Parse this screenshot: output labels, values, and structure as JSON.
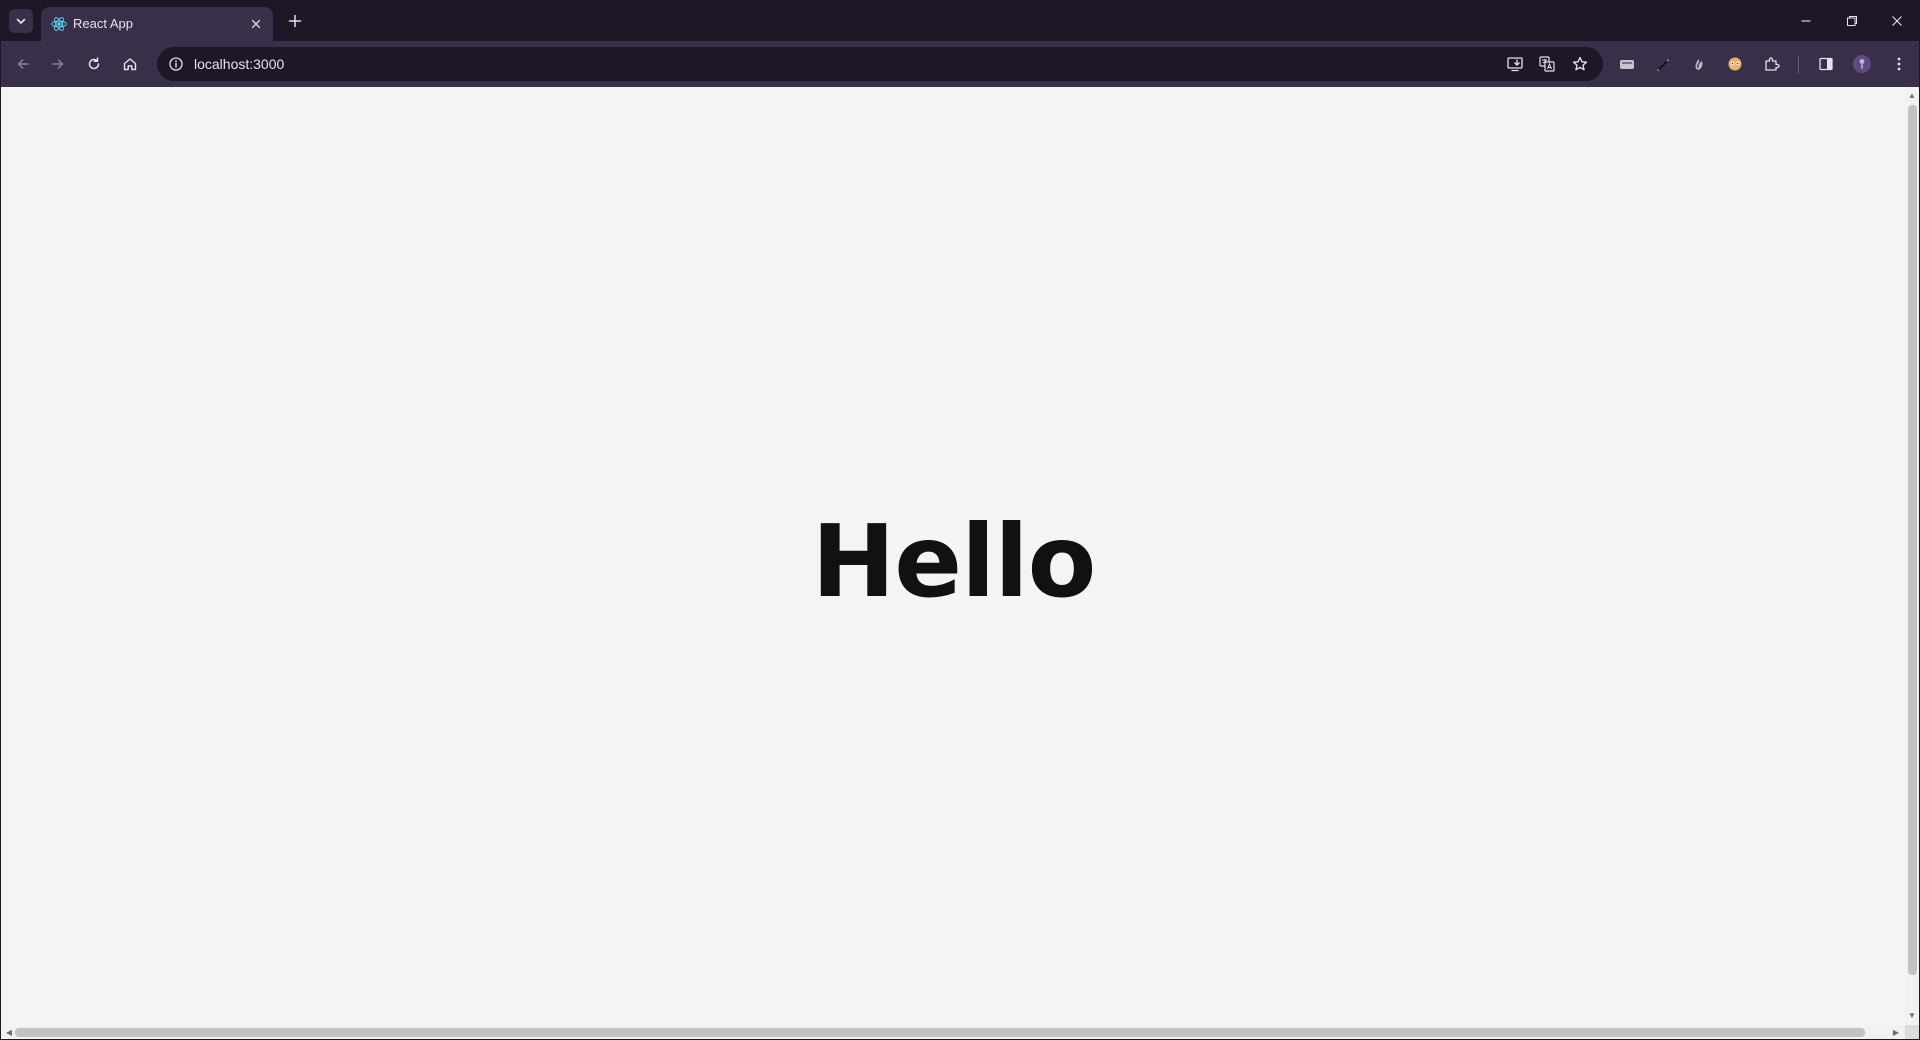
{
  "browser": {
    "tab": {
      "title": "React App",
      "favicon": "react-icon"
    },
    "address_bar": {
      "url": "localhost:3000"
    },
    "toolbar_icons": [
      "back-arrow-icon",
      "forward-arrow-icon",
      "reload-icon",
      "home-icon",
      "site-info-icon",
      "install-app-icon",
      "translate-icon",
      "bookmark-star-icon",
      "extension-1-icon",
      "extension-pen-icon",
      "extension-3-icon",
      "extension-face-icon",
      "extensions-puzzle-icon",
      "side-panel-icon",
      "profile-avatar",
      "menu-kebab-icon"
    ],
    "colors": {
      "tabstrip_bg": "#1f1628",
      "toolbar_bg": "#3a2f48",
      "page_bg": "#f4f4f4",
      "heading_color": "#111111"
    }
  },
  "page": {
    "heading": "Hello"
  }
}
